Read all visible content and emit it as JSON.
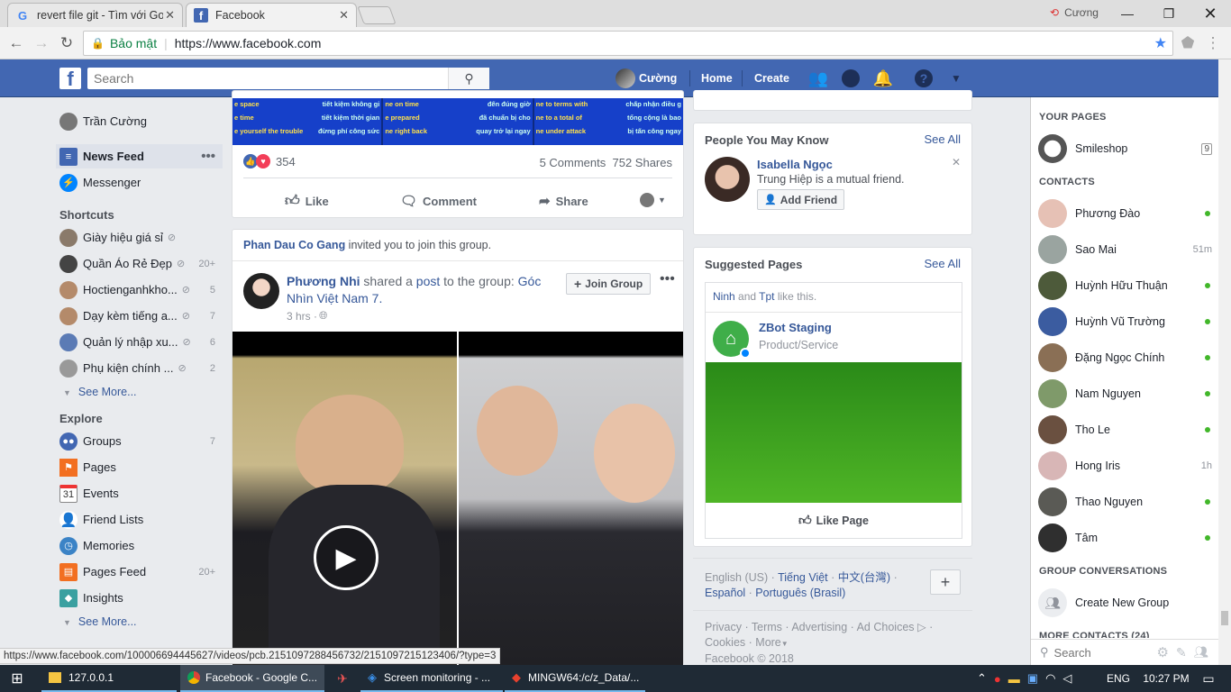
{
  "browser": {
    "tabs": [
      {
        "title": "revert file git - Tìm với Go",
        "icon": "G"
      },
      {
        "title": "Facebook",
        "icon": "f"
      }
    ],
    "user": "Cương",
    "security_label": "Bảo mật",
    "url": "https://www.facebook.com",
    "status_url": "https://www.facebook.com/100006694445627/videos/pcb.2151097288456732/2151097215123406/?type=3"
  },
  "fb": {
    "search_placeholder": "Search",
    "user_name": "Cường",
    "home": "Home",
    "create": "Create",
    "brand_color": "#4267b2"
  },
  "left": {
    "profile": "Trần Cường",
    "news_feed": "News Feed",
    "messenger": "Messenger",
    "shortcuts_title": "Shortcuts",
    "shortcuts": [
      {
        "label": "Giày hiệu giá sỉ",
        "count": ""
      },
      {
        "label": "Quần Áo Rẻ Đẹp",
        "count": "20+"
      },
      {
        "label": "Hoctienganhkho...",
        "count": "5"
      },
      {
        "label": "Dạy kèm tiếng a...",
        "count": "7"
      },
      {
        "label": "Quản lý nhập xu...",
        "count": "6"
      },
      {
        "label": "Phụ kiện chính ...",
        "count": "2"
      }
    ],
    "see_more": "See More...",
    "explore_title": "Explore",
    "explore": [
      {
        "label": "Groups",
        "count": "7"
      },
      {
        "label": "Pages",
        "count": ""
      },
      {
        "label": "Events",
        "count": ""
      },
      {
        "label": "Friend Lists",
        "count": ""
      },
      {
        "label": "Memories",
        "count": ""
      },
      {
        "label": "Pages Feed",
        "count": "20+"
      },
      {
        "label": "Insights",
        "count": ""
      }
    ],
    "see_more2": "See More..."
  },
  "feed": {
    "banner_texts": [
      "e space",
      "tiết kiệm không gi",
      "ne on time",
      "đến đúng giờ",
      "ne to terms with",
      "chấp nhận điều g",
      "e time",
      "tiết kiệm thời gian",
      "e prepared",
      "đã chuẩn bị cho",
      "ne to a total of",
      "tổng cộng là bao",
      "e yourself the trouble",
      "đừng phí công sức",
      "ne right back",
      "quay trở lại ngay",
      "ne under attack",
      "bị tấn công ngay"
    ],
    "reactions_count": "354",
    "comments": "5 Comments",
    "shares": "752 Shares",
    "like": "Like",
    "comment": "Comment",
    "share": "Share",
    "invite_name": "Phan Dau Co Gang",
    "invite_text": " invited you to join this group.",
    "poster": "Phương Nhi",
    "shared_text": " shared a ",
    "post_word": "post",
    "to_group": " to the group: ",
    "group_name": "Góc Nhìn Việt Nam 7.",
    "time": "3 hrs · ",
    "join_group": "Join Group"
  },
  "right": {
    "pymk_title": "People You May Know",
    "see_all": "See All",
    "friend_name": "Isabella Ngọc",
    "mutual": "Trung Hiệp is a mutual friend.",
    "add_friend": "Add Friend",
    "suggested_title": "Suggested Pages",
    "see_all2": "See All",
    "like_names": [
      "Ninh",
      "Tpt"
    ],
    "and": " and ",
    "like_this": " like this.",
    "page_name": "ZBot Staging",
    "page_cat": "Product/Service",
    "like_page": "Like Page",
    "languages": [
      "English (US)",
      "Tiếng Việt",
      "中文(台灣)",
      "Español",
      "Português (Brasil)"
    ],
    "footer_links": [
      "Privacy",
      "Terms",
      "Advertising",
      "Ad Choices",
      "Cookies",
      "More"
    ],
    "copyright": "Facebook © 2018"
  },
  "chat": {
    "your_pages": "YOUR PAGES",
    "page": "Smileshop",
    "page_count": "9",
    "contacts_title": "CONTACTS",
    "contacts": [
      {
        "name": "Phương Đào",
        "status": "online"
      },
      {
        "name": "Sao Mai",
        "status": "51m"
      },
      {
        "name": "Huỳnh Hữu Thuận",
        "status": "online"
      },
      {
        "name": "Huỳnh Vũ Trường",
        "status": "online"
      },
      {
        "name": "Đặng Ngọc Chính",
        "status": "online"
      },
      {
        "name": "Nam Nguyen",
        "status": "online"
      },
      {
        "name": "Tho Le",
        "status": "online"
      },
      {
        "name": "Hong Iris",
        "status": "1h"
      },
      {
        "name": "Thao Nguyen",
        "status": "online"
      },
      {
        "name": "Tâm",
        "status": "online"
      }
    ],
    "group_conv": "GROUP CONVERSATIONS",
    "create_group": "Create New Group",
    "more_contacts": "MORE CONTACTS (24)",
    "search_placeholder": "Search"
  },
  "taskbar": {
    "items": [
      "127.0.0.1",
      "Facebook - Google C...",
      "Screen monitoring - ...",
      "MINGW64:/c/z_Data/..."
    ],
    "lang": "ENG",
    "time": "10:27 PM"
  }
}
